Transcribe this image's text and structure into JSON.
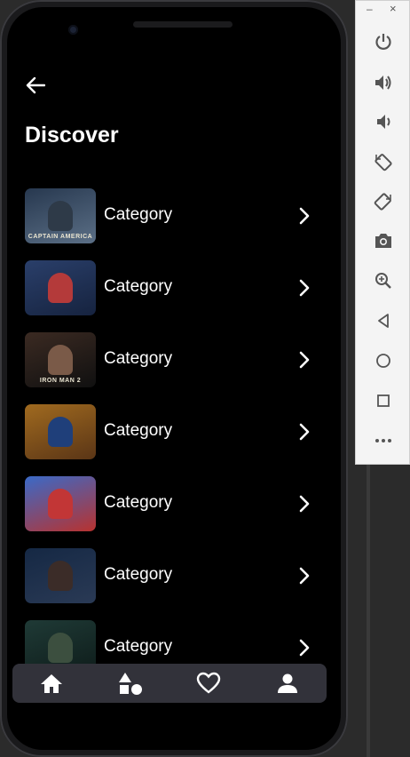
{
  "screen": {
    "title": "Discover",
    "back_icon": "arrow-left-icon"
  },
  "categories": [
    {
      "label": "Category",
      "poster_caption": "CAPTAIN AMERICA",
      "colors": [
        "#27384f",
        "#5b6f86"
      ],
      "figure": "#2e3a48"
    },
    {
      "label": "Category",
      "poster_caption": "",
      "colors": [
        "#2a3f6a",
        "#16233f"
      ],
      "figure": "#b43a3a"
    },
    {
      "label": "Category",
      "poster_caption": "IRON MAN 2",
      "colors": [
        "#3b2a22",
        "#101010"
      ],
      "figure": "#7a5a48"
    },
    {
      "label": "Category",
      "poster_caption": "",
      "colors": [
        "#a06a1f",
        "#5a3516"
      ],
      "figure": "#1f3f7a"
    },
    {
      "label": "Category",
      "poster_caption": "",
      "colors": [
        "#3a6ac8",
        "#b8322f"
      ],
      "figure": "#c23636"
    },
    {
      "label": "Category",
      "poster_caption": "",
      "colors": [
        "#152844",
        "#2a3a55"
      ],
      "figure": "#3b2c28"
    },
    {
      "label": "Category",
      "poster_caption": "",
      "colors": [
        "#1f3a36",
        "#0e1c1a"
      ],
      "figure": "#3c4f3f"
    }
  ],
  "bottom_nav": [
    {
      "name": "nav-home",
      "icon": "home-icon"
    },
    {
      "name": "nav-categories",
      "icon": "shapes-icon"
    },
    {
      "name": "nav-favorites",
      "icon": "heart-icon"
    },
    {
      "name": "nav-profile",
      "icon": "person-icon"
    }
  ],
  "emulator_toolbar": {
    "minimize_label": "–",
    "close_label": "×",
    "buttons": [
      "power-icon",
      "volume-up-icon",
      "volume-down-icon",
      "rotate-left-icon",
      "rotate-right-icon",
      "camera-icon",
      "zoom-icon",
      "back-triangle-icon",
      "home-circle-icon",
      "overview-square-icon",
      "more-icon"
    ]
  },
  "colors": {
    "screen_bg": "#000000",
    "nav_bg": "#32323a",
    "text": "#ffffff"
  }
}
